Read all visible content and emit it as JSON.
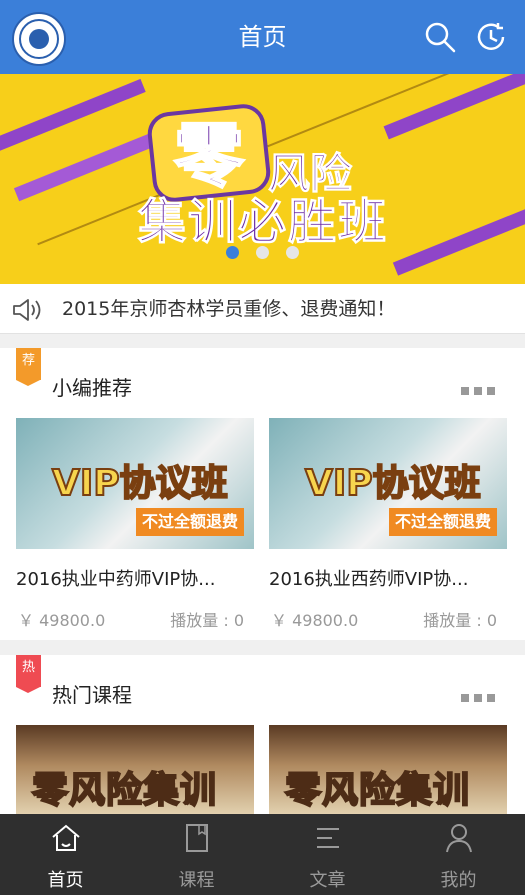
{
  "header": {
    "title": "首页",
    "search_icon": "search-icon",
    "history_icon": "history-icon",
    "accent": "#3b7fd9"
  },
  "banner": {
    "big_char": "零",
    "line1": "风险",
    "line2": "集训必胜班",
    "slide_count": 3,
    "active_slide": 0
  },
  "notice": {
    "text": "2015年京师杏林学员重修、退费通知！"
  },
  "recommended": {
    "tag": "荐",
    "title": "小编推荐",
    "items": [
      {
        "thumb_title": "VIP协议班",
        "thumb_ribbon": "不过全额退费",
        "name": "2016执业中药师VIP协...",
        "price": "￥ 49800.0",
        "plays": "播放量 : 0"
      },
      {
        "thumb_title": "VIP协议班",
        "thumb_ribbon": "不过全额退费",
        "name": "2016执业西药师VIP协...",
        "price": "￥ 49800.0",
        "plays": "播放量 : 0"
      }
    ]
  },
  "hot": {
    "tag": "热",
    "title": "热门课程",
    "items": [
      {
        "thumb_title": "零风险集训"
      },
      {
        "thumb_title": "零风险集训"
      }
    ]
  },
  "tabbar": {
    "items": [
      {
        "label": "首页",
        "icon": "home-icon",
        "active": true
      },
      {
        "label": "课程",
        "icon": "book-icon",
        "active": false
      },
      {
        "label": "文章",
        "icon": "article-icon",
        "active": false
      },
      {
        "label": "我的",
        "icon": "user-icon",
        "active": false
      }
    ]
  }
}
